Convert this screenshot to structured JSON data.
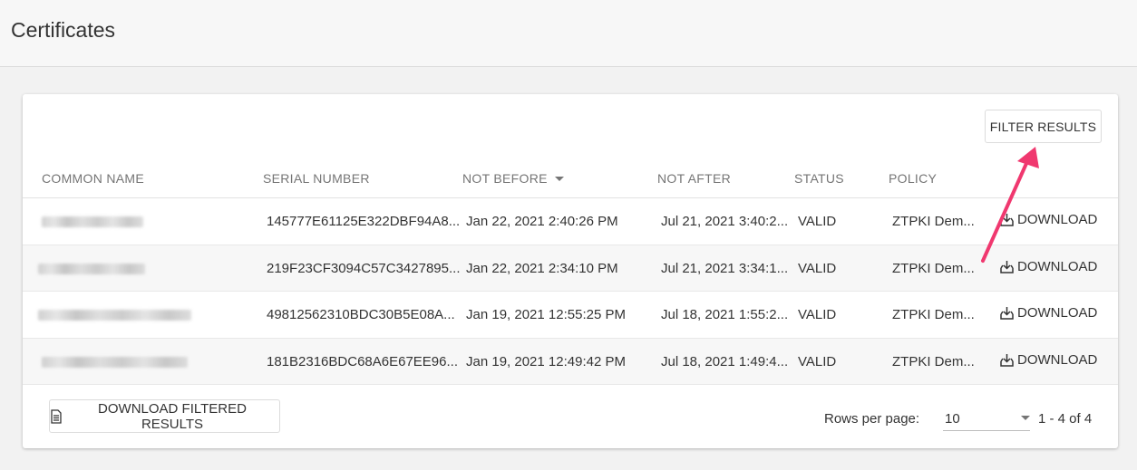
{
  "page": {
    "title": "Certificates"
  },
  "toolbar": {
    "filter_label": "FILTER RESULTS"
  },
  "table": {
    "columns": {
      "common_name": "COMMON NAME",
      "serial_number": "SERIAL NUMBER",
      "not_before": "NOT BEFORE",
      "not_after": "NOT AFTER",
      "status": "STATUS",
      "policy": "POLICY"
    },
    "sort": {
      "column": "not_before",
      "direction": "descending"
    },
    "rows": [
      {
        "common_name": "zoom2.zoom.us",
        "serial": "145777E61125E322DBF94A8...",
        "not_before": "Jan 22, 2021 2:40:26 PM",
        "not_after": "Jul 21, 2021 3:40:2...",
        "status": "VALID",
        "policy": "ZTPKI Dem...",
        "action": "DOWNLOAD"
      },
      {
        "common_name": "",
        "serial": "219F23CF3094C57C3427895...",
        "not_before": "Jan 22, 2021 2:34:10 PM",
        "not_after": "Jul 21, 2021 3:34:1...",
        "status": "VALID",
        "policy": "ZTPKI Dem...",
        "action": "DOWNLOAD"
      },
      {
        "common_name": "",
        "serial": "49812562310BDC30B5E08A...",
        "not_before": "Jan 19, 2021 12:55:25 PM",
        "not_after": "Jul 18, 2021 1:55:2...",
        "status": "VALID",
        "policy": "ZTPKI Dem...",
        "action": "DOWNLOAD"
      },
      {
        "common_name": "",
        "serial": "181B2316BDC68A6E67EE96...",
        "not_before": "Jan 19, 2021 12:49:42 PM",
        "not_after": "Jul 18, 2021 1:49:4...",
        "status": "VALID",
        "policy": "ZTPKI Dem...",
        "action": "DOWNLOAD"
      }
    ]
  },
  "footer": {
    "download_filtered_label": "DOWNLOAD FILTERED RESULTS",
    "rows_per_page_label": "Rows per page:",
    "rows_per_page_value": "10",
    "range_text": "1 - 4 of 4"
  },
  "icons": {
    "download": "download-tray-icon",
    "document": "document-icon",
    "sort": "caret-down-icon",
    "select": "caret-down-icon"
  },
  "colors": {
    "annotation_arrow": "#f0386f",
    "header_bg": "#f7f7f7",
    "page_bg": "#f2f2f2",
    "card_bg": "#ffffff",
    "striped_row_bg": "#f7f7f7"
  }
}
